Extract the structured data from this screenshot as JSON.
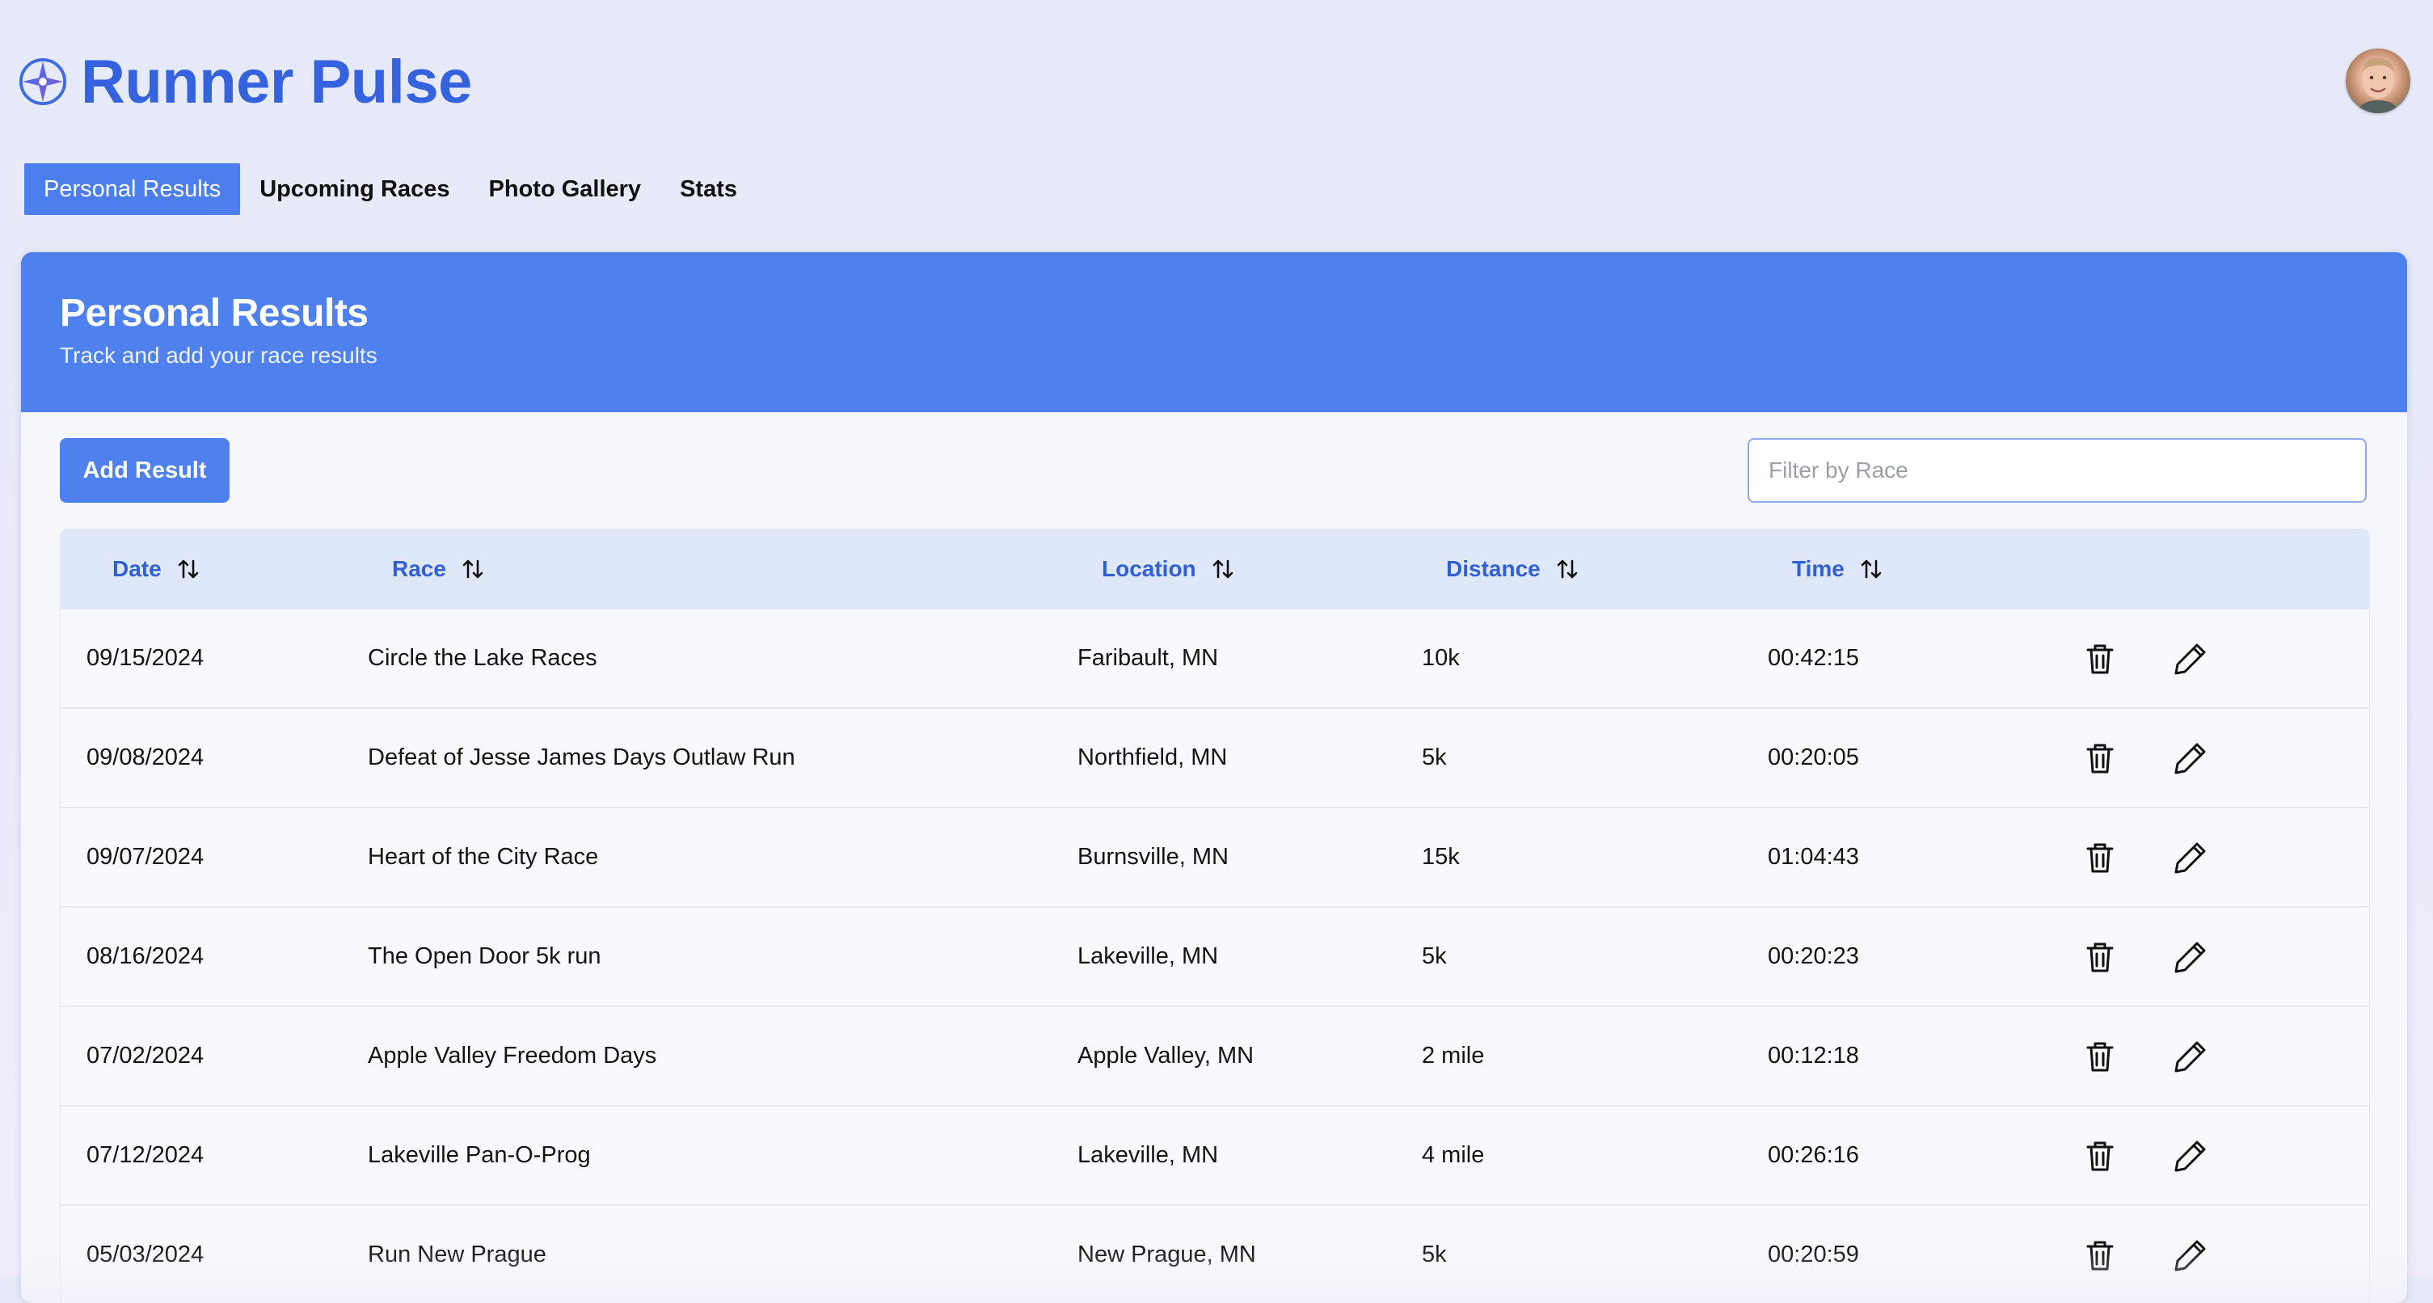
{
  "app": {
    "title": "Runner Pulse"
  },
  "nav": {
    "tabs": [
      {
        "label": "Personal Results",
        "active": true
      },
      {
        "label": "Upcoming Races",
        "active": false
      },
      {
        "label": "Photo Gallery",
        "active": false
      },
      {
        "label": "Stats",
        "active": false
      }
    ]
  },
  "card": {
    "title": "Personal Results",
    "subtitle": "Track and add your race results"
  },
  "toolbar": {
    "add_label": "Add Result",
    "filter_placeholder": "Filter by Race",
    "filter_value": ""
  },
  "table": {
    "columns": [
      "Date",
      "Race",
      "Location",
      "Distance",
      "Time"
    ],
    "rows": [
      [
        "09/15/2024",
        "Circle the Lake Races",
        "Faribault, MN",
        "10k",
        "00:42:15"
      ],
      [
        "09/08/2024",
        "Defeat of Jesse James Days Outlaw Run",
        "Northfield, MN",
        "5k",
        "00:20:05"
      ],
      [
        "09/07/2024",
        "Heart of the City Race",
        "Burnsville, MN",
        "15k",
        "01:04:43"
      ],
      [
        "08/16/2024",
        "The Open Door 5k run",
        "Lakeville, MN",
        "5k",
        "00:20:23"
      ],
      [
        "07/02/2024",
        "Apple Valley Freedom Days",
        "Apple Valley, MN",
        "2 mile",
        "00:12:18"
      ],
      [
        "07/12/2024",
        "Lakeville Pan-O-Prog",
        "Lakeville, MN",
        "4 mile",
        "00:26:16"
      ],
      [
        "05/03/2024",
        "Run New Prague",
        "New Prague, MN",
        "5k",
        "00:20:59"
      ]
    ]
  },
  "icons": {
    "logo": "compass-star-icon",
    "sort": "sort-arrows-icon",
    "delete": "trash-icon",
    "edit": "pencil-icon"
  },
  "colors": {
    "brand": "#3563e0",
    "accent": "#4e80ee",
    "header_row": "#dfe8fa"
  }
}
